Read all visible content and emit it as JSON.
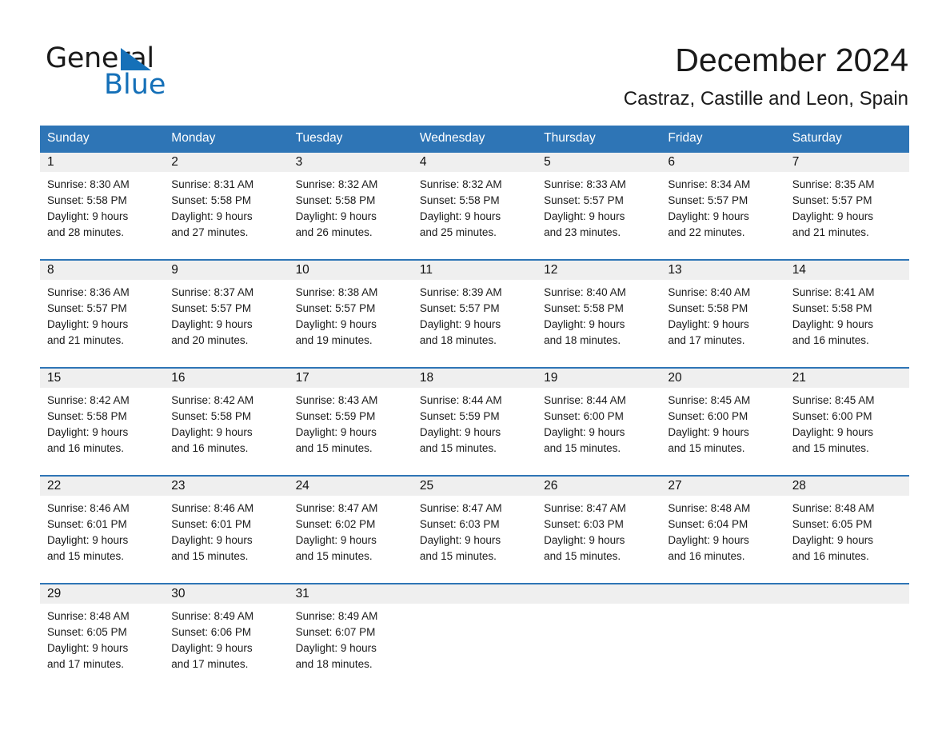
{
  "brand": {
    "name_part1": "General",
    "name_part2": "Blue",
    "logo_triangle": "blue-triangle-icon",
    "accent_color": "#1570b8"
  },
  "header": {
    "title": "December 2024",
    "subtitle": "Castraz, Castille and Leon, Spain"
  },
  "theme": {
    "header_row_color": "#2e75b6",
    "day_band_color": "#efefef",
    "text_color": "#1a1a1a"
  },
  "weekdays": [
    "Sunday",
    "Monday",
    "Tuesday",
    "Wednesday",
    "Thursday",
    "Friday",
    "Saturday"
  ],
  "weeks": [
    [
      {
        "day": "1",
        "sunrise": "Sunrise: 8:30 AM",
        "sunset": "Sunset: 5:58 PM",
        "daylight_line1": "Daylight: 9 hours",
        "daylight_line2": "and 28 minutes."
      },
      {
        "day": "2",
        "sunrise": "Sunrise: 8:31 AM",
        "sunset": "Sunset: 5:58 PM",
        "daylight_line1": "Daylight: 9 hours",
        "daylight_line2": "and 27 minutes."
      },
      {
        "day": "3",
        "sunrise": "Sunrise: 8:32 AM",
        "sunset": "Sunset: 5:58 PM",
        "daylight_line1": "Daylight: 9 hours",
        "daylight_line2": "and 26 minutes."
      },
      {
        "day": "4",
        "sunrise": "Sunrise: 8:32 AM",
        "sunset": "Sunset: 5:58 PM",
        "daylight_line1": "Daylight: 9 hours",
        "daylight_line2": "and 25 minutes."
      },
      {
        "day": "5",
        "sunrise": "Sunrise: 8:33 AM",
        "sunset": "Sunset: 5:57 PM",
        "daylight_line1": "Daylight: 9 hours",
        "daylight_line2": "and 23 minutes."
      },
      {
        "day": "6",
        "sunrise": "Sunrise: 8:34 AM",
        "sunset": "Sunset: 5:57 PM",
        "daylight_line1": "Daylight: 9 hours",
        "daylight_line2": "and 22 minutes."
      },
      {
        "day": "7",
        "sunrise": "Sunrise: 8:35 AM",
        "sunset": "Sunset: 5:57 PM",
        "daylight_line1": "Daylight: 9 hours",
        "daylight_line2": "and 21 minutes."
      }
    ],
    [
      {
        "day": "8",
        "sunrise": "Sunrise: 8:36 AM",
        "sunset": "Sunset: 5:57 PM",
        "daylight_line1": "Daylight: 9 hours",
        "daylight_line2": "and 21 minutes."
      },
      {
        "day": "9",
        "sunrise": "Sunrise: 8:37 AM",
        "sunset": "Sunset: 5:57 PM",
        "daylight_line1": "Daylight: 9 hours",
        "daylight_line2": "and 20 minutes."
      },
      {
        "day": "10",
        "sunrise": "Sunrise: 8:38 AM",
        "sunset": "Sunset: 5:57 PM",
        "daylight_line1": "Daylight: 9 hours",
        "daylight_line2": "and 19 minutes."
      },
      {
        "day": "11",
        "sunrise": "Sunrise: 8:39 AM",
        "sunset": "Sunset: 5:57 PM",
        "daylight_line1": "Daylight: 9 hours",
        "daylight_line2": "and 18 minutes."
      },
      {
        "day": "12",
        "sunrise": "Sunrise: 8:40 AM",
        "sunset": "Sunset: 5:58 PM",
        "daylight_line1": "Daylight: 9 hours",
        "daylight_line2": "and 18 minutes."
      },
      {
        "day": "13",
        "sunrise": "Sunrise: 8:40 AM",
        "sunset": "Sunset: 5:58 PM",
        "daylight_line1": "Daylight: 9 hours",
        "daylight_line2": "and 17 minutes."
      },
      {
        "day": "14",
        "sunrise": "Sunrise: 8:41 AM",
        "sunset": "Sunset: 5:58 PM",
        "daylight_line1": "Daylight: 9 hours",
        "daylight_line2": "and 16 minutes."
      }
    ],
    [
      {
        "day": "15",
        "sunrise": "Sunrise: 8:42 AM",
        "sunset": "Sunset: 5:58 PM",
        "daylight_line1": "Daylight: 9 hours",
        "daylight_line2": "and 16 minutes."
      },
      {
        "day": "16",
        "sunrise": "Sunrise: 8:42 AM",
        "sunset": "Sunset: 5:58 PM",
        "daylight_line1": "Daylight: 9 hours",
        "daylight_line2": "and 16 minutes."
      },
      {
        "day": "17",
        "sunrise": "Sunrise: 8:43 AM",
        "sunset": "Sunset: 5:59 PM",
        "daylight_line1": "Daylight: 9 hours",
        "daylight_line2": "and 15 minutes."
      },
      {
        "day": "18",
        "sunrise": "Sunrise: 8:44 AM",
        "sunset": "Sunset: 5:59 PM",
        "daylight_line1": "Daylight: 9 hours",
        "daylight_line2": "and 15 minutes."
      },
      {
        "day": "19",
        "sunrise": "Sunrise: 8:44 AM",
        "sunset": "Sunset: 6:00 PM",
        "daylight_line1": "Daylight: 9 hours",
        "daylight_line2": "and 15 minutes."
      },
      {
        "day": "20",
        "sunrise": "Sunrise: 8:45 AM",
        "sunset": "Sunset: 6:00 PM",
        "daylight_line1": "Daylight: 9 hours",
        "daylight_line2": "and 15 minutes."
      },
      {
        "day": "21",
        "sunrise": "Sunrise: 8:45 AM",
        "sunset": "Sunset: 6:00 PM",
        "daylight_line1": "Daylight: 9 hours",
        "daylight_line2": "and 15 minutes."
      }
    ],
    [
      {
        "day": "22",
        "sunrise": "Sunrise: 8:46 AM",
        "sunset": "Sunset: 6:01 PM",
        "daylight_line1": "Daylight: 9 hours",
        "daylight_line2": "and 15 minutes."
      },
      {
        "day": "23",
        "sunrise": "Sunrise: 8:46 AM",
        "sunset": "Sunset: 6:01 PM",
        "daylight_line1": "Daylight: 9 hours",
        "daylight_line2": "and 15 minutes."
      },
      {
        "day": "24",
        "sunrise": "Sunrise: 8:47 AM",
        "sunset": "Sunset: 6:02 PM",
        "daylight_line1": "Daylight: 9 hours",
        "daylight_line2": "and 15 minutes."
      },
      {
        "day": "25",
        "sunrise": "Sunrise: 8:47 AM",
        "sunset": "Sunset: 6:03 PM",
        "daylight_line1": "Daylight: 9 hours",
        "daylight_line2": "and 15 minutes."
      },
      {
        "day": "26",
        "sunrise": "Sunrise: 8:47 AM",
        "sunset": "Sunset: 6:03 PM",
        "daylight_line1": "Daylight: 9 hours",
        "daylight_line2": "and 15 minutes."
      },
      {
        "day": "27",
        "sunrise": "Sunrise: 8:48 AM",
        "sunset": "Sunset: 6:04 PM",
        "daylight_line1": "Daylight: 9 hours",
        "daylight_line2": "and 16 minutes."
      },
      {
        "day": "28",
        "sunrise": "Sunrise: 8:48 AM",
        "sunset": "Sunset: 6:05 PM",
        "daylight_line1": "Daylight: 9 hours",
        "daylight_line2": "and 16 minutes."
      }
    ],
    [
      {
        "day": "29",
        "sunrise": "Sunrise: 8:48 AM",
        "sunset": "Sunset: 6:05 PM",
        "daylight_line1": "Daylight: 9 hours",
        "daylight_line2": "and 17 minutes."
      },
      {
        "day": "30",
        "sunrise": "Sunrise: 8:49 AM",
        "sunset": "Sunset: 6:06 PM",
        "daylight_line1": "Daylight: 9 hours",
        "daylight_line2": "and 17 minutes."
      },
      {
        "day": "31",
        "sunrise": "Sunrise: 8:49 AM",
        "sunset": "Sunset: 6:07 PM",
        "daylight_line1": "Daylight: 9 hours",
        "daylight_line2": "and 18 minutes."
      },
      {
        "day": "",
        "sunrise": "",
        "sunset": "",
        "daylight_line1": "",
        "daylight_line2": ""
      },
      {
        "day": "",
        "sunrise": "",
        "sunset": "",
        "daylight_line1": "",
        "daylight_line2": ""
      },
      {
        "day": "",
        "sunrise": "",
        "sunset": "",
        "daylight_line1": "",
        "daylight_line2": ""
      },
      {
        "day": "",
        "sunrise": "",
        "sunset": "",
        "daylight_line1": "",
        "daylight_line2": ""
      }
    ]
  ]
}
